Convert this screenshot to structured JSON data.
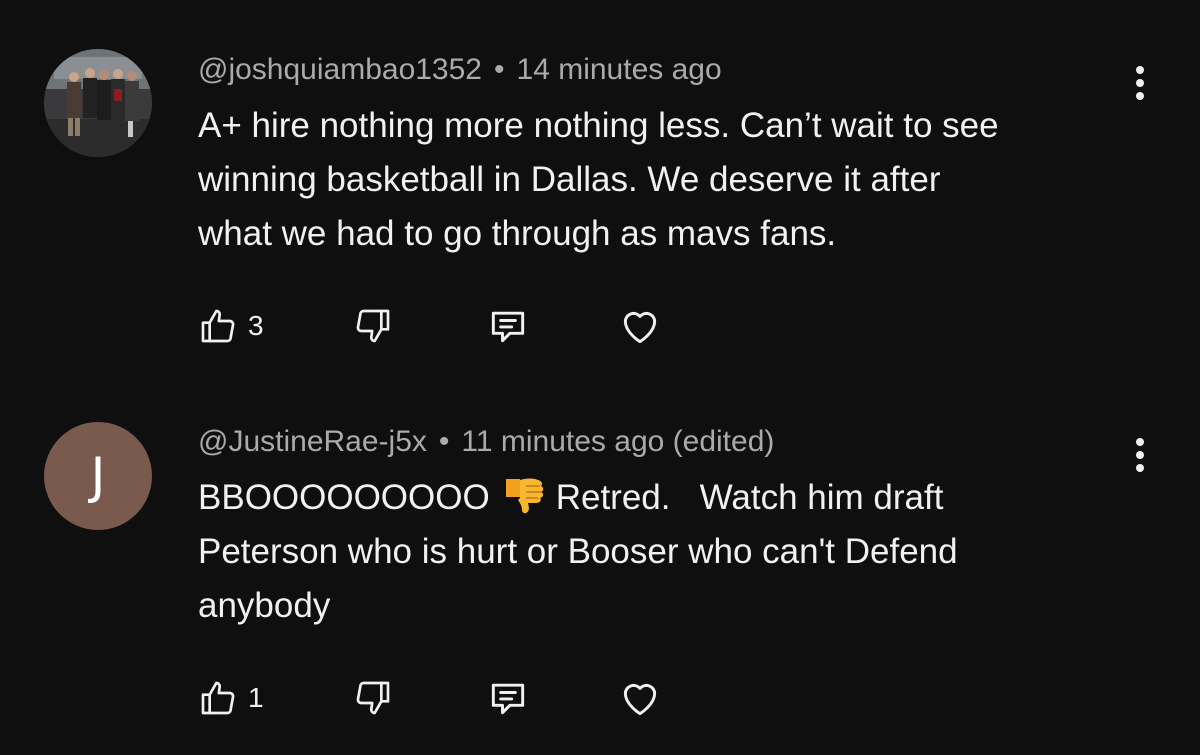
{
  "comments": [
    {
      "handle": "@joshquiambao1352",
      "separator": "•",
      "time": "14 minutes ago",
      "body_lines": [
        "A+ hire nothing more nothing less. Can’t wait to see",
        "winning basketball in Dallas. We deserve it after",
        "what we had to go through as mavs fans."
      ],
      "like_count": "3",
      "avatar": "photo"
    },
    {
      "handle": "@JustineRae-j5x",
      "separator": "•",
      "time": "11 minutes ago (edited)",
      "avatar_letter": "J",
      "body_before_emoji": "BBOOOOOOOOO",
      "emoji": "thumbs-down-emoji",
      "body_after_emoji": "Retred.   Watch him draft",
      "body_lines": [
        "Peterson who is hurt or Booser who can't Defend",
        "anybody"
      ],
      "like_count": "1"
    }
  ],
  "colors": {
    "background": "#0f0f0f",
    "text_primary": "#f1f1f1",
    "text_secondary": "#aaaaaa",
    "avatar_letter_bg": "#7a5a4d"
  },
  "icons": [
    "thumbs-up-icon",
    "thumbs-down-icon",
    "reply-icon",
    "heart-icon",
    "more-vert-icon"
  ]
}
